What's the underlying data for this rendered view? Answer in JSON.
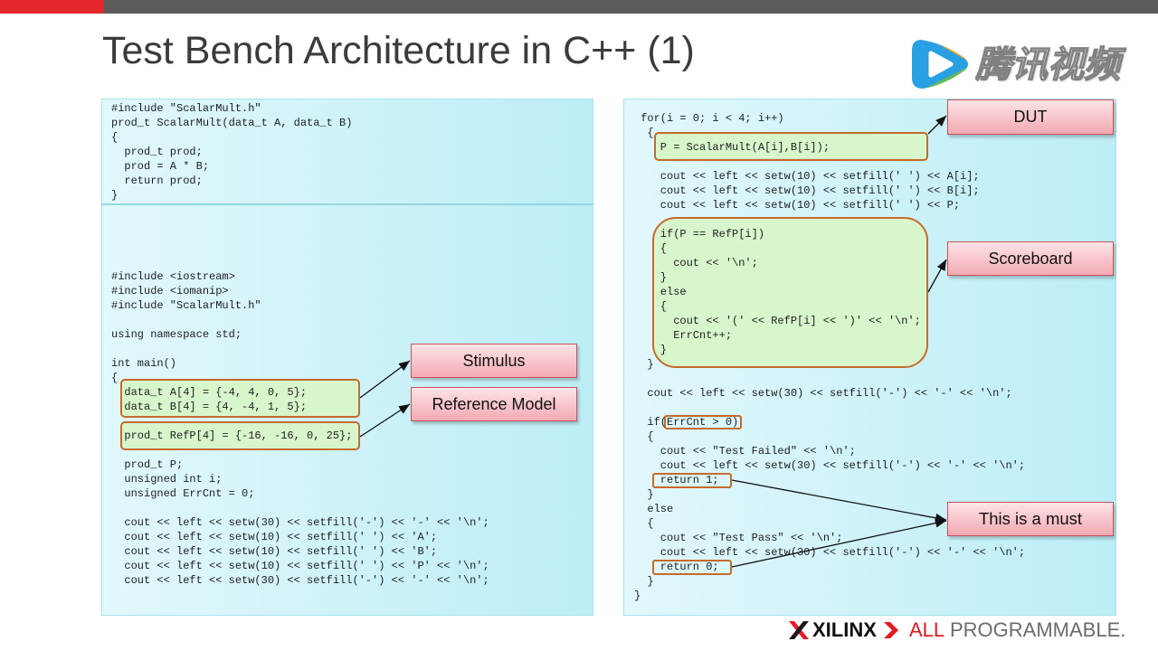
{
  "theme": {
    "accent_red": "#e4262d",
    "bar_gray": "#5a5a5a",
    "title_color": "#3b3b3b",
    "highlight_border": "#c46b2a",
    "highlight_fill": "#d8f6cc",
    "callout_border": "#c9505a",
    "brand_red": "#e31b23"
  },
  "title": "Test Bench Architecture in C++ (1)",
  "watermark": {
    "icon": "play-icon",
    "logo_text": "腾讯视频"
  },
  "left_panel": {
    "header_code": [
      "#include \"ScalarMult.h\"",
      "prod_t ScalarMult(data_t A, data_t B)",
      "{",
      "  prod_t prod;",
      "  prod = A * B;",
      "  return prod;",
      "}"
    ],
    "main_code": [
      "#include <iostream>",
      "#include <iomanip>",
      "#include \"ScalarMult.h\"",
      "",
      "using namespace std;",
      "",
      "int main()",
      "{",
      "  data_t A[4] = {-4, 4, 0, 5};",
      "  data_t B[4] = {4, -4, 1, 5};",
      "",
      "  prod_t RefP[4] = {-16, -16, 0, 25};",
      "",
      "  prod_t P;",
      "  unsigned int i;",
      "  unsigned ErrCnt = 0;",
      "",
      "  cout << left << setw(30) << setfill('-') << '-' << '\\n';",
      "  cout << left << setw(10) << setfill(' ') << 'A';",
      "  cout << left << setw(10) << setfill(' ') << 'B';",
      "  cout << left << setw(10) << setfill(' ') << 'P' << '\\n';",
      "  cout << left << setw(30) << setfill('-') << '-' << '\\n';"
    ]
  },
  "right_panel": {
    "code": [
      " for(i = 0; i < 4; i++)",
      "  {",
      "    P = ScalarMult(A[i],B[i]);",
      "",
      "    cout << left << setw(10) << setfill(' ') << A[i];",
      "    cout << left << setw(10) << setfill(' ') << B[i];",
      "    cout << left << setw(10) << setfill(' ') << P;",
      "",
      "    if(P == RefP[i])",
      "    {",
      "      cout << '\\n';",
      "    }",
      "    else",
      "    {",
      "      cout << '(' << RefP[i] << ')' << '\\n';",
      "      ErrCnt++;",
      "    }",
      "  }",
      "",
      "  cout << left << setw(30) << setfill('-') << '-' << '\\n';",
      "",
      "  if(ErrCnt > 0)",
      "  {",
      "    cout << \"Test Failed\" << '\\n';",
      "    cout << left << setw(30) << setfill('-') << '-' << '\\n';",
      "    return 1;",
      "  }",
      "  else",
      "  {",
      "    cout << \"Test Pass\" << '\\n';",
      "    cout << left << setw(30) << setfill('-') << '-' << '\\n';",
      "    return 0;",
      "  }",
      "}"
    ]
  },
  "callouts": {
    "stimulus": "Stimulus",
    "reference_model": "Reference Model",
    "dut": "DUT",
    "scoreboard": "Scoreboard",
    "must": "This is a must"
  },
  "footer": {
    "logo_icon": "xilinx-x-icon",
    "brand": "XILINX",
    "chevron_icon": "chevron-right-icon",
    "tagline_accent": "ALL",
    "tagline": "PROGRAMMABLE."
  }
}
